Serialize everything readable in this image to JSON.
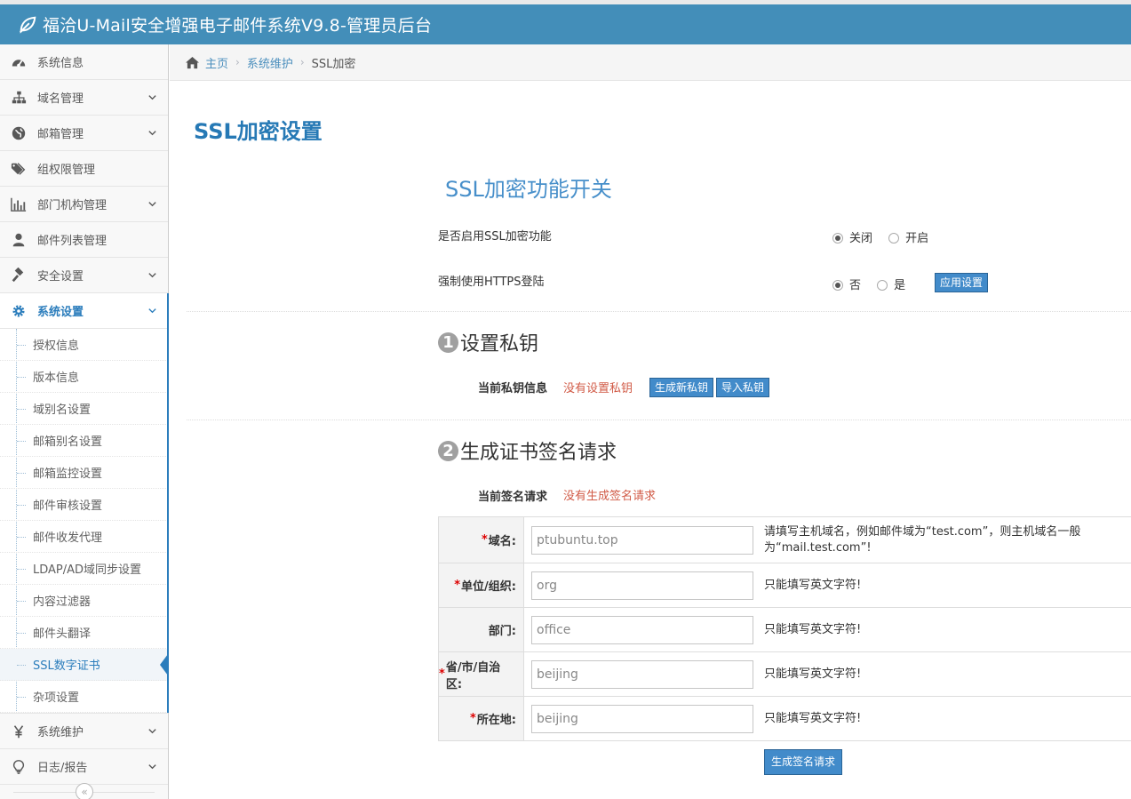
{
  "header": {
    "title": "福洽U-Mail安全增强电子邮件系统V9.8-管理员后台"
  },
  "sidebar": {
    "items": [
      {
        "label": "系统信息",
        "icon": "dashboard-icon",
        "has_children": false
      },
      {
        "label": "域名管理",
        "icon": "sitemap-icon",
        "has_children": true
      },
      {
        "label": "邮箱管理",
        "icon": "globe-icon",
        "has_children": true
      },
      {
        "label": "组权限管理",
        "icon": "tags-icon",
        "has_children": false
      },
      {
        "label": "部门机构管理",
        "icon": "bar-chart-icon",
        "has_children": true
      },
      {
        "label": "邮件列表管理",
        "icon": "user-icon",
        "has_children": false
      },
      {
        "label": "安全设置",
        "icon": "gavel-icon",
        "has_children": true
      },
      {
        "label": "系统设置",
        "icon": "gear-icon",
        "has_children": true,
        "active": true
      }
    ],
    "subitems": [
      "授权信息",
      "版本信息",
      "域别名设置",
      "邮箱别名设置",
      "邮箱监控设置",
      "邮件审核设置",
      "邮件收发代理",
      "LDAP/AD域同步设置",
      "内容过滤器",
      "邮件头翻译",
      "SSL数字证书",
      "杂项设置"
    ],
    "active_subitem": "SSL数字证书",
    "bottom_items": [
      {
        "label": "系统维护",
        "icon": "yen-icon",
        "has_children": true
      },
      {
        "label": "日志/报告",
        "icon": "lightbulb-icon",
        "has_children": true
      }
    ],
    "collapse_glyph": "«"
  },
  "breadcrumb": {
    "home": "主页",
    "mid": "系统维护",
    "current": "SSL加密"
  },
  "page": {
    "title": "SSL加密设置"
  },
  "ssl_switch": {
    "title": "SSL加密功能开关",
    "enable_label": "是否启用SSL加密功能",
    "enable_off": "关闭",
    "enable_on": "开启",
    "enable_selected": "关闭",
    "https_label": "强制使用HTTPS登陆",
    "https_no": "否",
    "https_yes": "是",
    "https_selected": "否",
    "apply_button": "应用设置"
  },
  "step1": {
    "num": "1",
    "title": "设置私钥",
    "info_label": "当前私钥信息",
    "info_value": "没有设置私钥",
    "gen_button": "生成新私钥",
    "import_button": "导入私钥"
  },
  "step2": {
    "num": "2",
    "title": "生成证书签名请求",
    "info_label": "当前签名请求",
    "info_value": "没有生成签名请求",
    "submit_button": "生成签名请求",
    "fields": [
      {
        "required": true,
        "label": "域名:",
        "value": "ptubuntu.top",
        "hint": "请填写主机域名，例如邮件域为“test.com”，则主机域名一般为“mail.test.com”!"
      },
      {
        "required": true,
        "label": "单位/组织:",
        "value": "org",
        "hint": "只能填写英文字符!"
      },
      {
        "required": false,
        "label": "部门:",
        "value": "office",
        "hint": "只能填写英文字符!"
      },
      {
        "required": true,
        "label": "省/市/自治区:",
        "value": "beijing",
        "hint": "只能填写英文字符!"
      },
      {
        "required": true,
        "label": "所在地:",
        "value": "beijing",
        "hint": "只能填写英文字符!"
      }
    ]
  }
}
